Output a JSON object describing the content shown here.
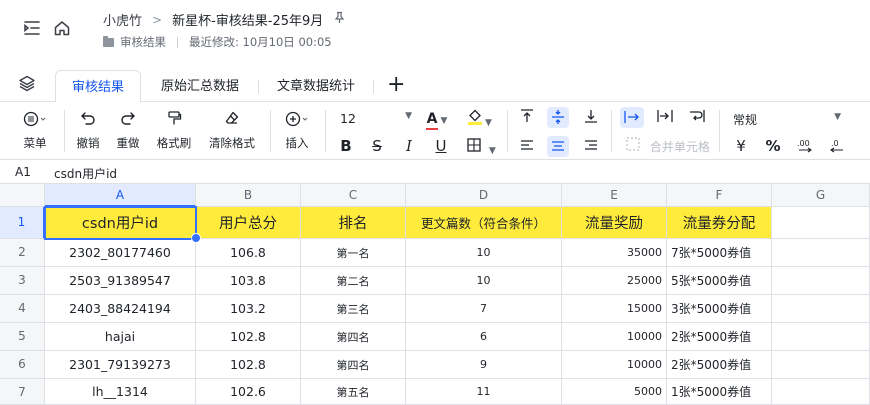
{
  "header": {
    "breadcrumb_root": "小虎竹",
    "breadcrumb_sep": ">",
    "doc_title": "新星杯-审核结果-25年9月",
    "folder": "审核结果",
    "last_modified": "最近修改: 10月10日 00:05"
  },
  "tabs": [
    {
      "label": "审核结果",
      "active": true
    },
    {
      "label": "原始汇总数据",
      "active": false
    },
    {
      "label": "文章数据统计",
      "active": false
    }
  ],
  "toolbar": {
    "menu": "菜单",
    "undo": "撤销",
    "redo": "重做",
    "format_painter": "格式刷",
    "clear_format": "清除格式",
    "insert": "插入",
    "font_size": "12",
    "merge_cells": "合并单元格",
    "number_format": "常规",
    "currency_symbol": "¥",
    "percent_symbol": "%",
    "font_color": "#e8403c",
    "fill_color": "#ffeb3b"
  },
  "formula_bar": {
    "cell_ref": "A1",
    "value": "csdn用户id"
  },
  "columns": [
    "A",
    "B",
    "C",
    "D",
    "E",
    "F",
    "G"
  ],
  "rows": [
    "1",
    "2",
    "3",
    "4",
    "5",
    "6",
    "7"
  ],
  "table": {
    "headers": [
      "csdn用户id",
      "用户总分",
      "排名",
      "更文篇数（符合条件）",
      "流量奖励",
      "流量券分配"
    ],
    "header_fill": "#ffeb3b",
    "data": [
      [
        "2302_80177460",
        "106.8",
        "第一名",
        "10",
        "35000",
        "7张*5000券值"
      ],
      [
        "2503_91389547",
        "103.8",
        "第二名",
        "10",
        "25000",
        "5张*5000券值"
      ],
      [
        "2403_88424194",
        "103.2",
        "第三名",
        "7",
        "15000",
        "3张*5000券值"
      ],
      [
        "hajai",
        "102.8",
        "第四名",
        "6",
        "10000",
        "2张*5000券值"
      ],
      [
        "2301_79139273",
        "102.8",
        "第四名",
        "9",
        "10000",
        "2张*5000券值"
      ],
      [
        "lh__1314",
        "102.6",
        "第五名",
        "11",
        "5000",
        "1张*5000券值"
      ]
    ]
  }
}
